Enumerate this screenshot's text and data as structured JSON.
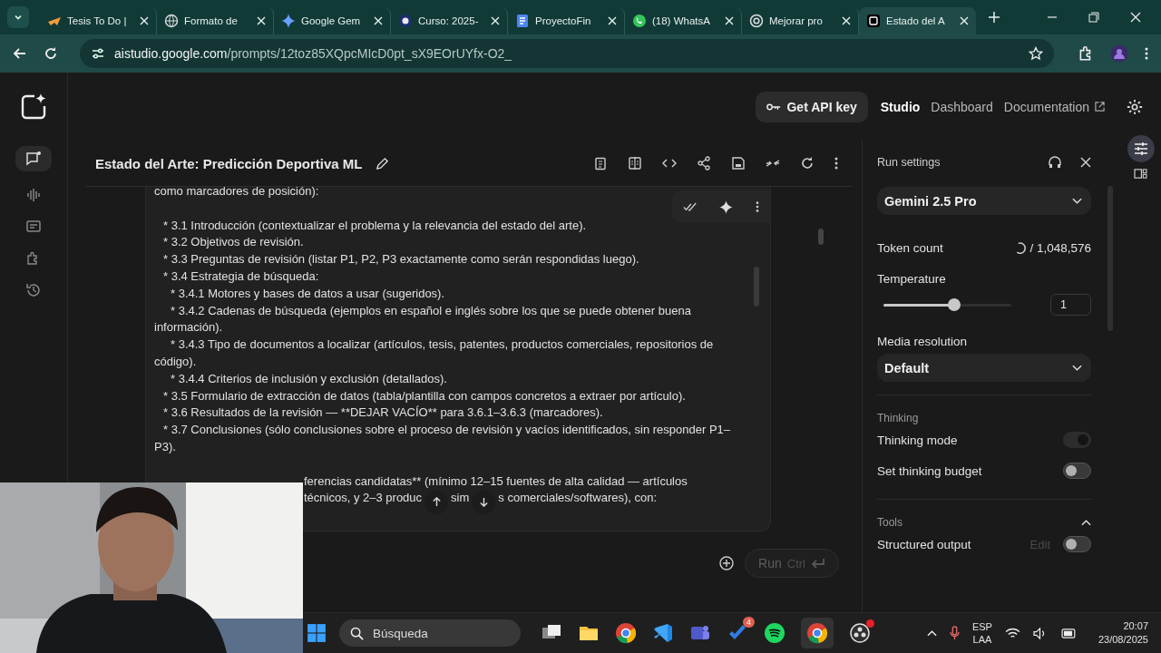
{
  "browser": {
    "tabs": [
      {
        "title": "Tesis To Do |",
        "selected": false
      },
      {
        "title": "Formato de",
        "selected": false
      },
      {
        "title": "Google Gem",
        "selected": false
      },
      {
        "title": "Curso: 2025-",
        "selected": false
      },
      {
        "title": "ProyectoFin",
        "selected": false
      },
      {
        "title": "(18) WhatsA",
        "selected": false
      },
      {
        "title": "Mejorar pro",
        "selected": false
      },
      {
        "title": "Estado del A",
        "selected": true
      }
    ],
    "url_host": "aistudio.google.com",
    "url_path": "/prompts/12toz85XQpcMIcD0pt_sX9EOrUYfx-O2_"
  },
  "header": {
    "api_key_button": "Get API key",
    "nav": [
      {
        "label": "Studio",
        "selected": true
      },
      {
        "label": "Dashboard",
        "selected": false
      },
      {
        "label": "Documentation",
        "selected": false
      }
    ]
  },
  "prompt": {
    "title": "Estado del Arte: Predicción Deportiva ML",
    "lines": [
      {
        "kind": "text",
        "text": "como marcadores de posición):"
      },
      {
        "kind": "gap"
      },
      {
        "kind": "item",
        "text": "* 3.1 Introducción (contextualizar el problema y la relevancia del estado del arte)."
      },
      {
        "kind": "item",
        "text": "* 3.2 Objetivos de revisión."
      },
      {
        "kind": "item",
        "text": "* 3.3 Preguntas de revisión (listar P1, P2, P3 exactamente como serán respondidas luego)."
      },
      {
        "kind": "item",
        "text": "* 3.4 Estrategia de búsqueda:"
      },
      {
        "kind": "subitem",
        "text": "* 3.4.1 Motores y bases de datos a usar (sugeridos)."
      },
      {
        "kind": "subitem",
        "text": "* 3.4.2 Cadenas de búsqueda (ejemplos en español e inglés sobre los que se puede obtener buena información)."
      },
      {
        "kind": "subitem",
        "text": "* 3.4.3 Tipo de documentos a localizar (artículos, tesis, patentes, productos comerciales, repositorios de código)."
      },
      {
        "kind": "subitem",
        "text": "* 3.4.4 Criterios de inclusión y exclusión (detallados)."
      },
      {
        "kind": "item",
        "text": "* 3.5 Formulario de extracción de datos (tabla/plantilla con campos concretos a extraer por artículo)."
      },
      {
        "kind": "item",
        "text": "* 3.6 Resultados de la revisión — **DEJAR VACÍO** para 3.6.1–3.6.3 (marcadores)."
      },
      {
        "kind": "item",
        "text": "* 3.7 Conclusiones (sólo conclusiones sobre el proceso de revisión y vacíos identificados, sin responder P1–P3)."
      },
      {
        "kind": "gap"
      }
    ],
    "partial_lines": [
      [
        "ferencias candidatas** (mínimo 12–15 fuentes de alta calidad — artículos"
      ],
      [
        "técnicos, y 2–3 produc",
        "sim",
        "s comerciales/softwares), con:"
      ]
    ],
    "run_button": "Run",
    "run_shortcut": "Ctrl"
  },
  "run_settings": {
    "title": "Run settings",
    "model": "Gemini 2.5 Pro",
    "token_label": "Token count",
    "token_value": "/ 1,048,576",
    "temperature_label": "Temperature",
    "temperature": {
      "level": 0.5,
      "value": "1"
    },
    "media_label": "Media resolution",
    "media_value": "Default",
    "thinking_heading": "Thinking",
    "toggles": [
      {
        "label": "Thinking mode",
        "on": true,
        "disabled": true
      },
      {
        "label": "Set thinking budget",
        "on": false,
        "disabled": false
      }
    ],
    "tools": {
      "heading": "Tools",
      "expanded": true,
      "items": [
        {
          "label": "Structured output",
          "action": "Edit",
          "on": false
        }
      ]
    }
  },
  "taskbar": {
    "search_placeholder": "Búsqueda",
    "badge": "4",
    "lang": "ESP",
    "layout": "LAA",
    "time": "20:07",
    "date": "23/08/2025"
  }
}
